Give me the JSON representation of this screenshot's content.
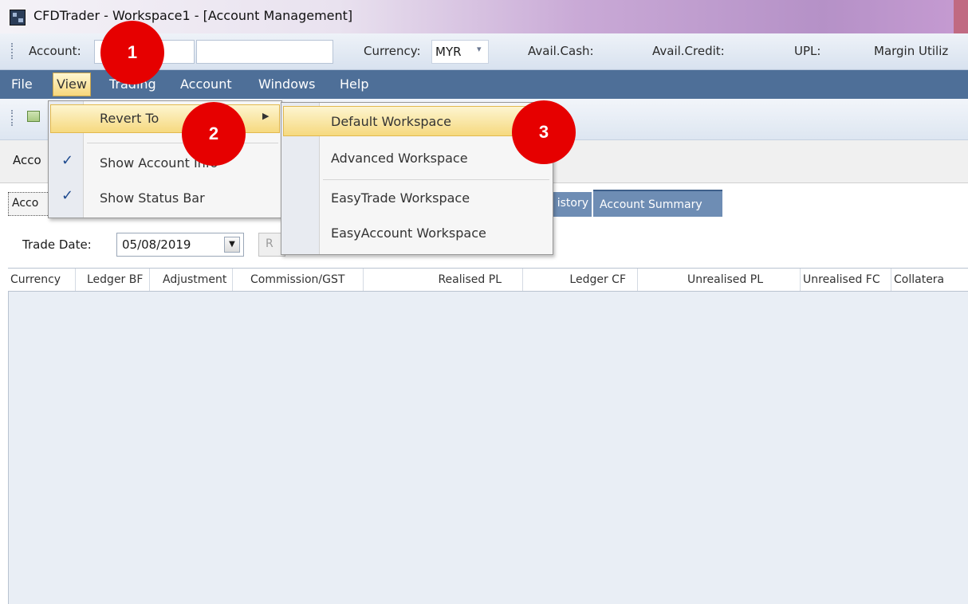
{
  "window": {
    "title": "CFDTrader - Workspace1 - [Account Management]"
  },
  "account_bar": {
    "account_label": "Account:",
    "currency_label": "Currency:",
    "currency_value": "MYR",
    "avail_cash_label": "Avail.Cash:",
    "avail_credit_label": "Avail.Credit:",
    "upl_label": "UPL:",
    "margin_label": "Margin Utiliz"
  },
  "menubar": {
    "items": [
      "File",
      "View",
      "Trading",
      "Account",
      "Windows",
      "Help"
    ]
  },
  "account_info": {
    "label": "Acco"
  },
  "tabs": {
    "first": "Acco",
    "history": "istory",
    "summary": "Account Summary"
  },
  "trade_date": {
    "label": "Trade Date:",
    "value": "05/08/2019",
    "button": "R"
  },
  "table": {
    "columns": [
      "Currency",
      "Ledger BF",
      "Adjustment",
      "Commission/GST",
      "Realised PL",
      "Ledger CF",
      "Unrealised PL",
      "Unrealised FC",
      "Collatera"
    ]
  },
  "view_menu": {
    "revert_to": "Revert To",
    "show_account_info": "Show Account Info",
    "show_status_bar": "Show Status Bar",
    "show_account_info_checked": true,
    "show_status_bar_checked": true
  },
  "revert_submenu": {
    "items": [
      "Default Workspace",
      "Advanced Workspace",
      "EasyTrade Workspace",
      "EasyAccount Workspace"
    ],
    "highlighted": "Default Workspace"
  },
  "annotations": {
    "step1": "1",
    "step2": "2",
    "step3": "3",
    "color": "#e60000"
  },
  "icons": [
    "app-icon",
    "toolbar-grid-icon",
    "checkmark-icon",
    "submenu-arrow-icon",
    "dropdown-arrow-icon"
  ]
}
